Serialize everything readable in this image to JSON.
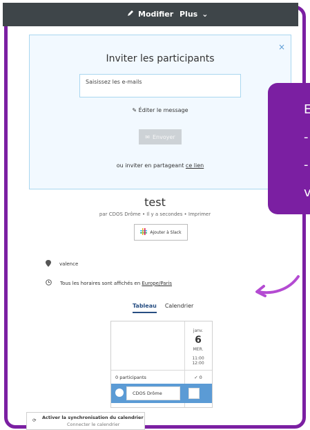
{
  "topbar": {
    "edit_label": "Modifier",
    "more_label": "Plus"
  },
  "invite": {
    "title": "Inviter les participants",
    "close": "×",
    "email_placeholder": "Saisissez les e-mails",
    "edit_message": "Éditer le message",
    "send_label": "Envoyer",
    "share_prefix": "ou inviter en partageant",
    "share_link": "ce lien"
  },
  "callout": {
    "line1": "E",
    "line2": "-",
    "line3": "-",
    "line4": "v"
  },
  "poll": {
    "title": "test",
    "meta": "par CDOS Drôme • Il y a secondes • Imprimer",
    "slack_button": "Ajouter à Slack",
    "location": "valence",
    "timezone_prefix": "Tous les horaires sont affichés en",
    "timezone_link": "Europe/Paris"
  },
  "tabs": {
    "table": "Tableau",
    "calendar": "Calendrier"
  },
  "grid": {
    "month": "janv.",
    "day": "6",
    "weekday": "MER.",
    "time_start": "11:00",
    "time_end": "12:00",
    "participants": "0 participants",
    "count": "0",
    "participant_name": "CDOS Drôme"
  },
  "sync": {
    "title": "Activer la synchronisation du calendrier",
    "subtitle": "Connecter le calendrier"
  },
  "colors": {
    "accent": "#7b1fa2",
    "topbar": "#3e4549",
    "invite_bg": "#f2f9ff",
    "row": "#5b9bd5"
  }
}
